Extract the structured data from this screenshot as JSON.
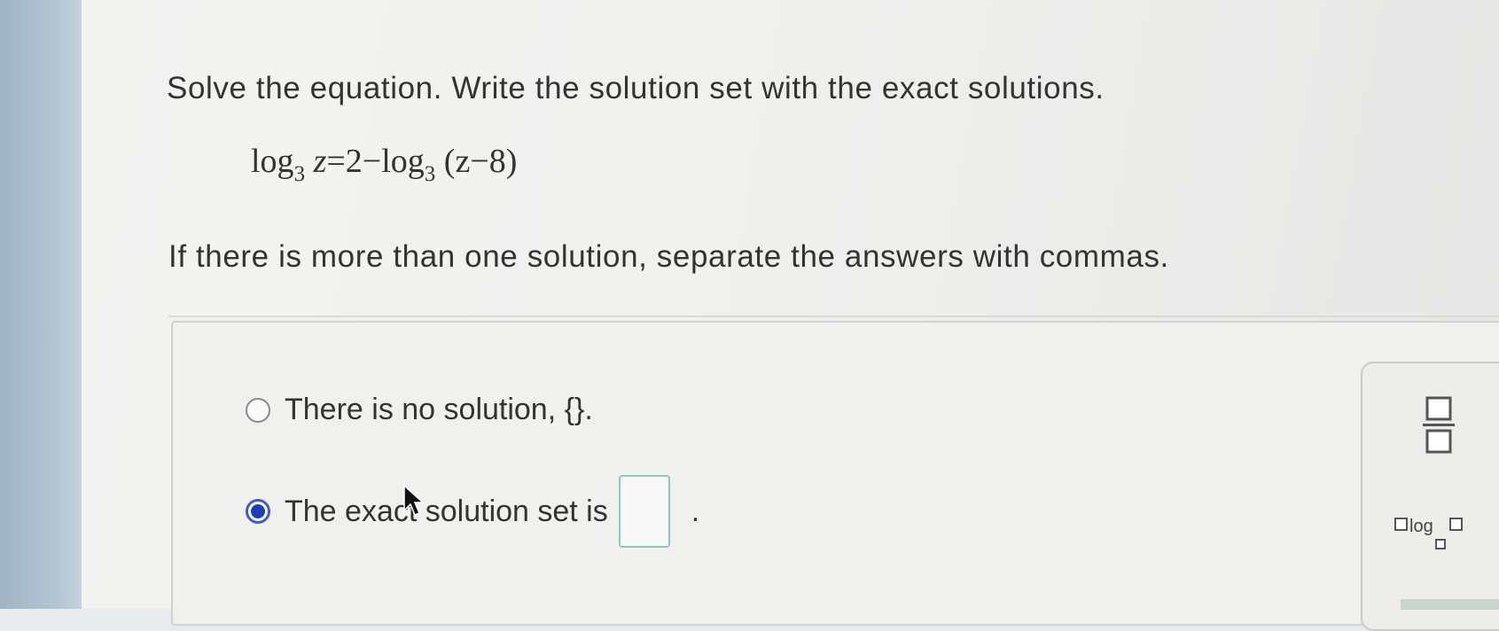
{
  "question": {
    "prompt": "Solve the equation. Write the solution set with the exact solutions.",
    "equation": {
      "lhs_fn": "log",
      "lhs_base": "3",
      "lhs_arg": "z",
      "equals": "=",
      "constant": "2",
      "minus": "−",
      "rhs_fn": "log",
      "rhs_base": "3",
      "rhs_arg": "(z−8)"
    },
    "instruction": "If there is more than one solution, separate the answers with commas."
  },
  "options": [
    {
      "text": "There is no solution, {}.",
      "selected": false
    },
    {
      "text": "The exact solution set is",
      "suffix": ".",
      "selected": true
    }
  ],
  "answer_value": "",
  "palette": {
    "fraction_icon": "fraction-template-icon",
    "log_label": "log"
  },
  "colors": {
    "radio_selected": "#1d3fb5",
    "answer_box_border": "#8dc7c0"
  }
}
